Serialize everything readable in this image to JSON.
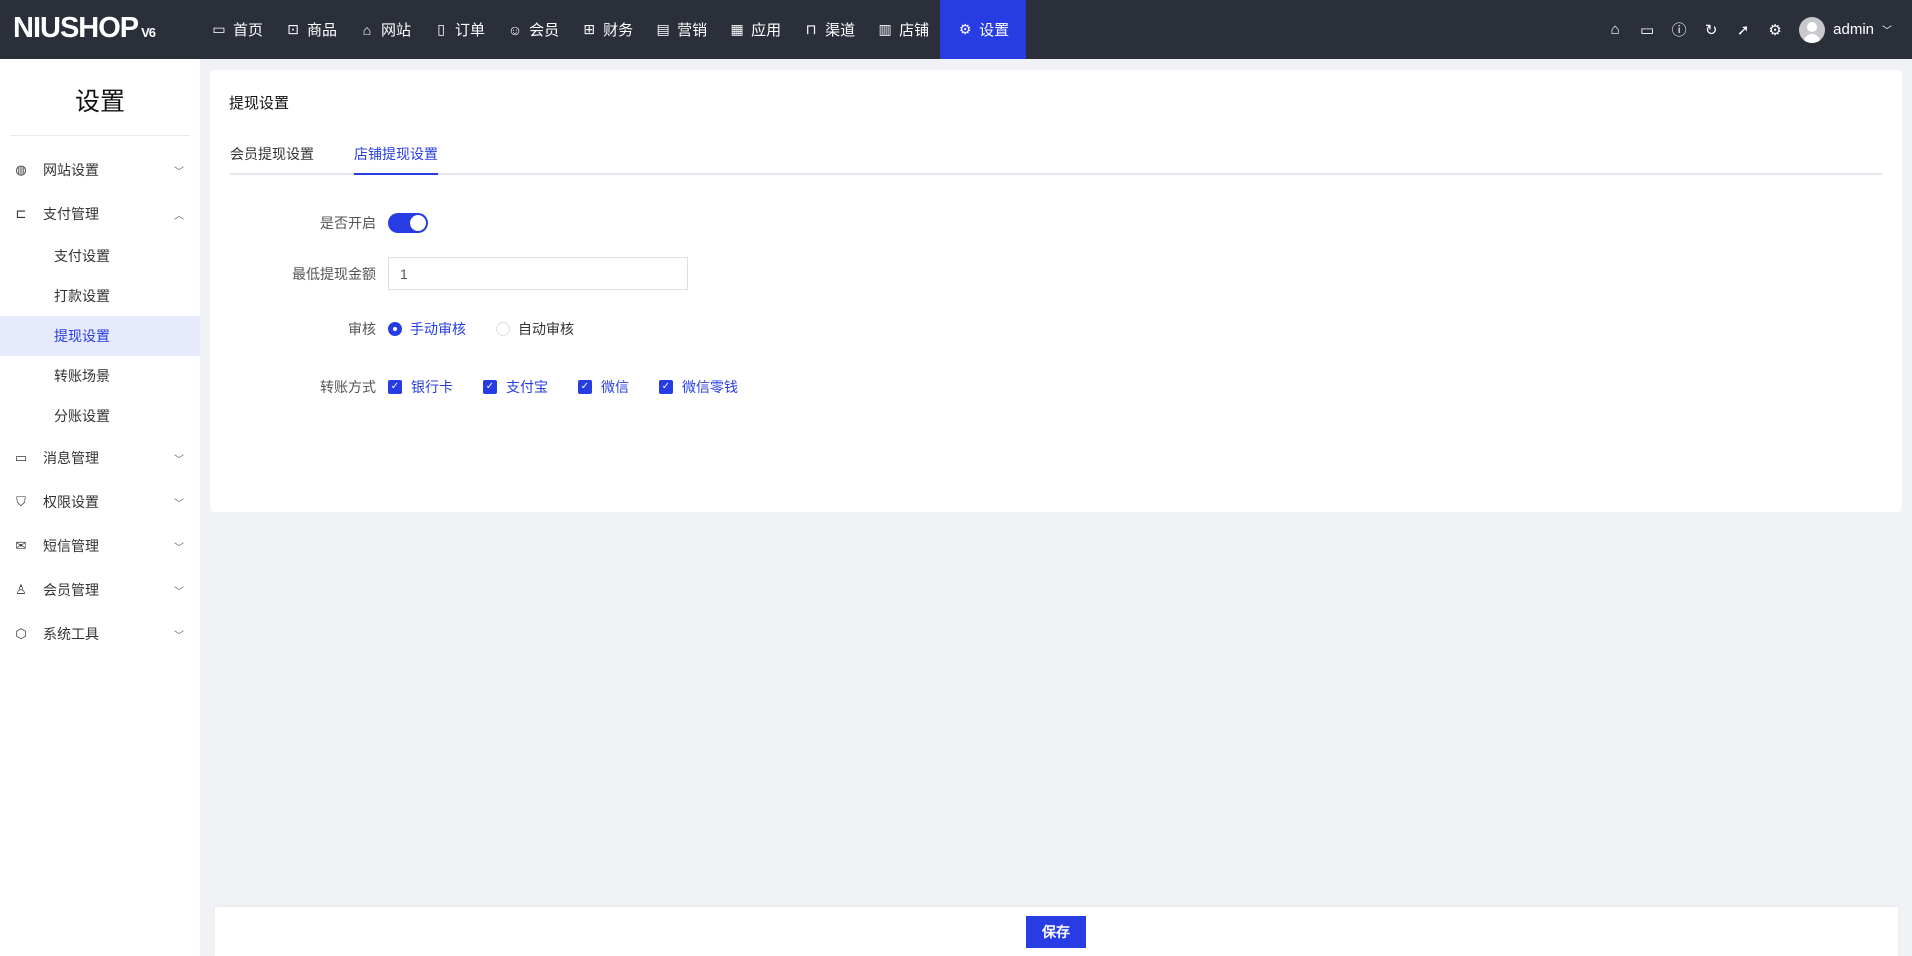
{
  "header": {
    "logo": "NIUSHOP",
    "logo_version": "V6",
    "nav": [
      {
        "label": "首页",
        "icon": "monitor-icon",
        "glyph": "▭"
      },
      {
        "label": "商品",
        "icon": "box-icon",
        "glyph": "⊡"
      },
      {
        "label": "网站",
        "icon": "site-icon",
        "glyph": "⌂"
      },
      {
        "label": "订单",
        "icon": "clipboard-icon",
        "glyph": "▯"
      },
      {
        "label": "会员",
        "icon": "member-icon",
        "glyph": "☺"
      },
      {
        "label": "财务",
        "icon": "finance-icon",
        "glyph": "⊞"
      },
      {
        "label": "营销",
        "icon": "marketing-icon",
        "glyph": "▤"
      },
      {
        "label": "应用",
        "icon": "apps-icon",
        "glyph": "▦"
      },
      {
        "label": "渠道",
        "icon": "channel-icon",
        "glyph": "⊓"
      },
      {
        "label": "店铺",
        "icon": "store-icon",
        "glyph": "▥"
      },
      {
        "label": "设置",
        "icon": "gear-icon",
        "glyph": "⚙"
      }
    ],
    "user": "admin"
  },
  "sidebar": {
    "title": "设置",
    "items": [
      {
        "label": "网站设置",
        "glyph": "◍",
        "chev": "﹀"
      },
      {
        "label": "支付管理",
        "glyph": "⊏",
        "chev": "︿"
      },
      {
        "label": "消息管理",
        "glyph": "▭",
        "chev": "﹀"
      },
      {
        "label": "权限设置",
        "glyph": "⛉",
        "chev": "﹀"
      },
      {
        "label": "短信管理",
        "glyph": "✉",
        "chev": "﹀"
      },
      {
        "label": "会员管理",
        "glyph": "♙",
        "chev": "﹀"
      },
      {
        "label": "系统工具",
        "glyph": "⬡",
        "chev": "﹀"
      }
    ],
    "sub_items": [
      "支付设置",
      "打款设置",
      "提现设置",
      "转账场景",
      "分账设置"
    ]
  },
  "main": {
    "title": "提现设置",
    "tabs": [
      "会员提现设置",
      "店铺提现设置"
    ],
    "form": {
      "enable_label": "是否开启",
      "enabled": true,
      "min_label": "最低提现金额",
      "min_value": "1",
      "audit_label": "审核",
      "audit_options": [
        "手动审核",
        "自动审核"
      ],
      "transfer_label": "转账方式",
      "transfer_options": [
        "银行卡",
        "支付宝",
        "微信",
        "微信零钱"
      ]
    },
    "save": "保存"
  },
  "colors": {
    "accent": "#273de3",
    "topbar": "#2b2f3a"
  }
}
